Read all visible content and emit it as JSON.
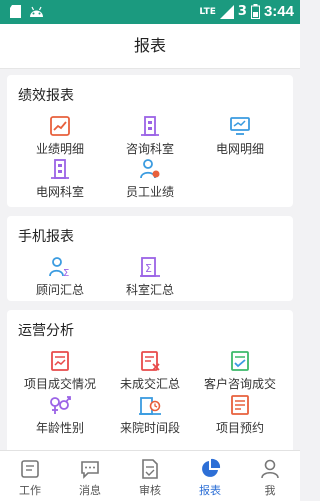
{
  "status_bar": {
    "network": "LTE",
    "battery_level": "3",
    "time": "3:44"
  },
  "header": {
    "title": "报表"
  },
  "sections": [
    {
      "title": "绩效报表",
      "items": [
        {
          "label": "业绩明细",
          "icon": "trend-chart-icon"
        },
        {
          "label": "咨询科室",
          "icon": "building-icon"
        },
        {
          "label": "电网明细",
          "icon": "monitor-icon"
        },
        {
          "label": "电网科室",
          "icon": "building-icon"
        },
        {
          "label": "员工业绩",
          "icon": "user-coin-icon"
        }
      ]
    },
    {
      "title": "手机报表",
      "items": [
        {
          "label": "顾问汇总",
          "icon": "user-sum-icon"
        },
        {
          "label": "科室汇总",
          "icon": "building-sum-icon"
        }
      ]
    },
    {
      "title": "运营分析",
      "items": [
        {
          "label": "项目成交情况",
          "icon": "deal-doc-icon"
        },
        {
          "label": "未成交汇总",
          "icon": "failed-doc-icon"
        },
        {
          "label": "客户咨询成交",
          "icon": "checked-doc-icon"
        },
        {
          "label": "年龄性别",
          "icon": "gender-icon"
        },
        {
          "label": "来院时间段",
          "icon": "clock-building-icon"
        },
        {
          "label": "项目预约",
          "icon": "appointment-icon"
        }
      ]
    }
  ],
  "tab_bar": [
    {
      "label": "工作",
      "icon": "document-icon",
      "active": false
    },
    {
      "label": "消息",
      "icon": "message-icon",
      "active": false
    },
    {
      "label": "审核",
      "icon": "review-icon",
      "active": false
    },
    {
      "label": "报表",
      "icon": "pie-chart-icon",
      "active": true
    },
    {
      "label": "我",
      "icon": "person-icon",
      "active": false
    }
  ],
  "colors": {
    "status_bar": "#1b9a7f",
    "accent": "#2d6fd6",
    "orange": "#e8603c",
    "purple": "#9b63e6",
    "blue": "#3a9be0",
    "red": "#e84b4b",
    "green": "#3cb96a"
  }
}
